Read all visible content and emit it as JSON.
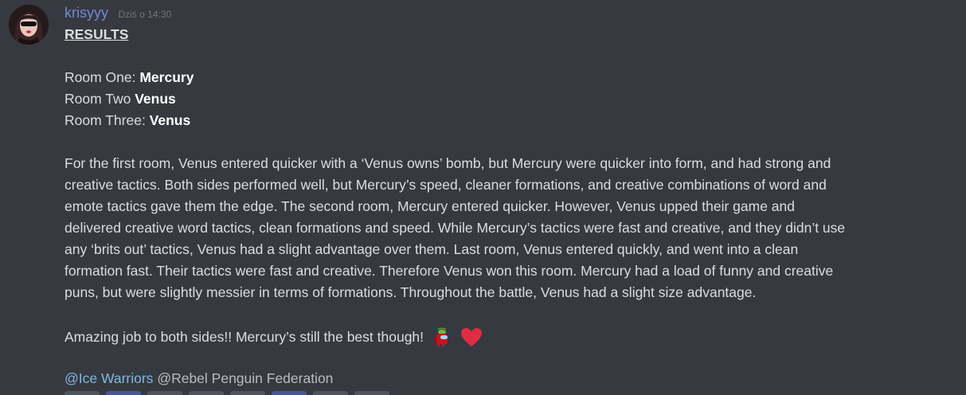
{
  "author": {
    "username": "krisyyy",
    "timestamp": "Dziś o 14:30"
  },
  "message": {
    "title": "RESULTS",
    "rooms": [
      {
        "label": "Room One: ",
        "winner": "Mercury"
      },
      {
        "label": "Room Two ",
        "winner": "Venus"
      },
      {
        "label": "Room Three: ",
        "winner": "Venus"
      }
    ],
    "summary_lines": [
      "For the first room, Venus entered quicker with a ‘Venus owns’ bomb, but Mercury were quicker into form, and had strong and",
      "creative tactics. Both sides performed well, but Mercury’s speed, cleaner formations, and creative combinations of word and",
      "emote tactics gave them the edge. The second room, Mercury entered quicker. However, Venus upped their game and",
      "delivered creative word tactics, clean formations and speed. While Mercury’s tactics were fast and creative, and they didn’t use",
      "any ‘brits out’ tactics, Venus had a slight advantage over them. Last room, Venus entered quickly, and went into a clean",
      "formation fast. Their tactics were fast and creative. Therefore Venus won this room. Mercury had a load of funny and creative",
      "puns, but were slightly messier in terms of formations. Throughout the battle, Venus had a slight size advantage."
    ],
    "closing": "Amazing job to both sides!! Mercury’s still the best though! ",
    "emojis": [
      "crewmate-emoji",
      "red-heart-emoji"
    ],
    "mentions": {
      "role1": "@Ice Warriors",
      "role2": "@Rebel Penguin Federation"
    }
  },
  "colors": {
    "background": "#36393f",
    "username": "#7289da",
    "mention_blue": "#7fb8e0"
  }
}
